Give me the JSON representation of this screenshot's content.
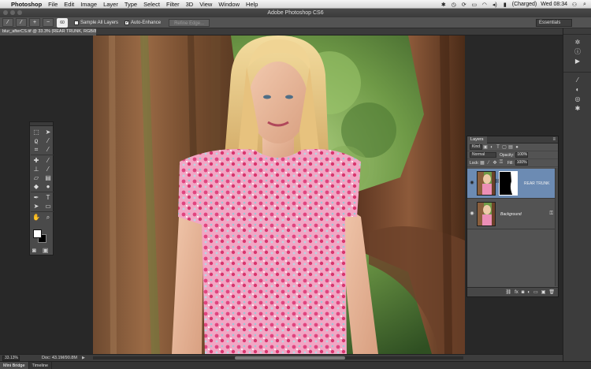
{
  "menubar": {
    "app_name": "Photoshop",
    "items": [
      "File",
      "Edit",
      "Image",
      "Layer",
      "Type",
      "Select",
      "Filter",
      "3D",
      "View",
      "Window",
      "Help"
    ],
    "battery": "(Charged)",
    "clock": "Wed 08:34"
  },
  "window": {
    "title": "Adobe Photoshop CS6"
  },
  "options": {
    "brush_size": "60",
    "sample_all_layers_label": "Sample All Layers",
    "auto_enhance_label": "Auto-Enhance",
    "sample_all_layers_checked": false,
    "auto_enhance_checked": true,
    "refine_edge_label": "Refine Edge...",
    "workspace": "Essentials"
  },
  "document": {
    "tab_label": "blur_afterCS.tif @ 33.3% (REAR TRUNK, RGB/8) *"
  },
  "layers_panel": {
    "tab_label": "Layers",
    "filter_kind": "Kind",
    "blend_mode": "Normal",
    "opacity_label": "Opacity:",
    "opacity_value": "100%",
    "lock_label": "Lock:",
    "fill_label": "Fill:",
    "fill_value": "100%",
    "layers": [
      {
        "name": "REAR TRUNK",
        "active": true,
        "has_mask": true
      },
      {
        "name": "Background",
        "active": false,
        "locked": true
      }
    ]
  },
  "status": {
    "zoom": "33.13%",
    "doc_info": "Doc: 43.1M/90.8M"
  },
  "bottom_tabs": [
    "Mini Bridge",
    "Timeline"
  ],
  "colors": {
    "foreground": "#ffffff",
    "background": "#000000",
    "selected_layer": "#6c8bb3"
  }
}
